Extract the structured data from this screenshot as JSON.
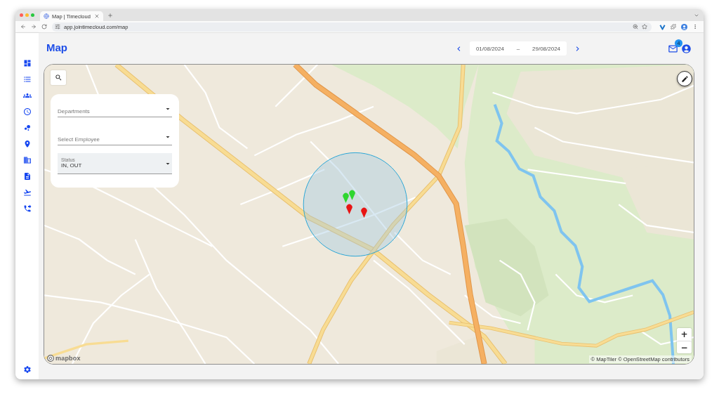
{
  "browser": {
    "tab": {
      "title": "Map | Timecloud"
    },
    "url": "app.jointimecloud.com/map"
  },
  "sidebar": {
    "items": [
      {
        "kind": "dashboard"
      },
      {
        "kind": "list"
      },
      {
        "kind": "team"
      },
      {
        "kind": "clock"
      },
      {
        "kind": "bubbles"
      },
      {
        "kind": "location"
      },
      {
        "kind": "building"
      },
      {
        "kind": "document"
      },
      {
        "kind": "flight"
      },
      {
        "kind": "phone"
      }
    ],
    "footer": {
      "kind": "settings"
    }
  },
  "header": {
    "title": "Map",
    "date_range": {
      "start": "01/08/2024",
      "separator": "–",
      "end": "29/08/2024"
    },
    "notifications": {
      "count": "4"
    }
  },
  "map": {
    "filters": [
      {
        "kind": "select",
        "placeholder": "Departments"
      },
      {
        "kind": "select",
        "placeholder": "Select Employee"
      },
      {
        "kind": "filled",
        "label": "Status",
        "value": "IN, OUT"
      }
    ],
    "markers": [
      {
        "color": "#2fd62f"
      },
      {
        "color": "#2fd62f"
      },
      {
        "color": "#e81414"
      },
      {
        "color": "#e81414"
      }
    ],
    "zoom_controls": [
      "+",
      "−"
    ],
    "logo": "mapbox",
    "attribution": "© MapTiler © OpenStreetMap contributors"
  }
}
